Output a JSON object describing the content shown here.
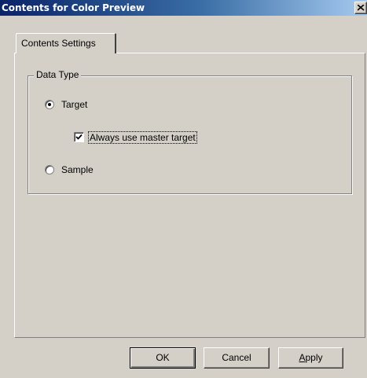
{
  "window": {
    "title": "Contents for Color Preview",
    "close_icon": "close-icon"
  },
  "tabs": [
    {
      "label": "Contents Settings",
      "selected": true
    }
  ],
  "data_type_group": {
    "title": "Data Type",
    "options": [
      {
        "label": "Target",
        "selected": true
      },
      {
        "label": "Sample",
        "selected": false
      }
    ],
    "always_use_master_target": {
      "label": "Always use master target",
      "checked": true
    }
  },
  "buttons": {
    "ok": "OK",
    "cancel": "Cancel",
    "apply": "Apply"
  },
  "colors": {
    "face": "#d4d0c8",
    "title_start": "#0a246a",
    "title_end": "#a6caf0"
  }
}
